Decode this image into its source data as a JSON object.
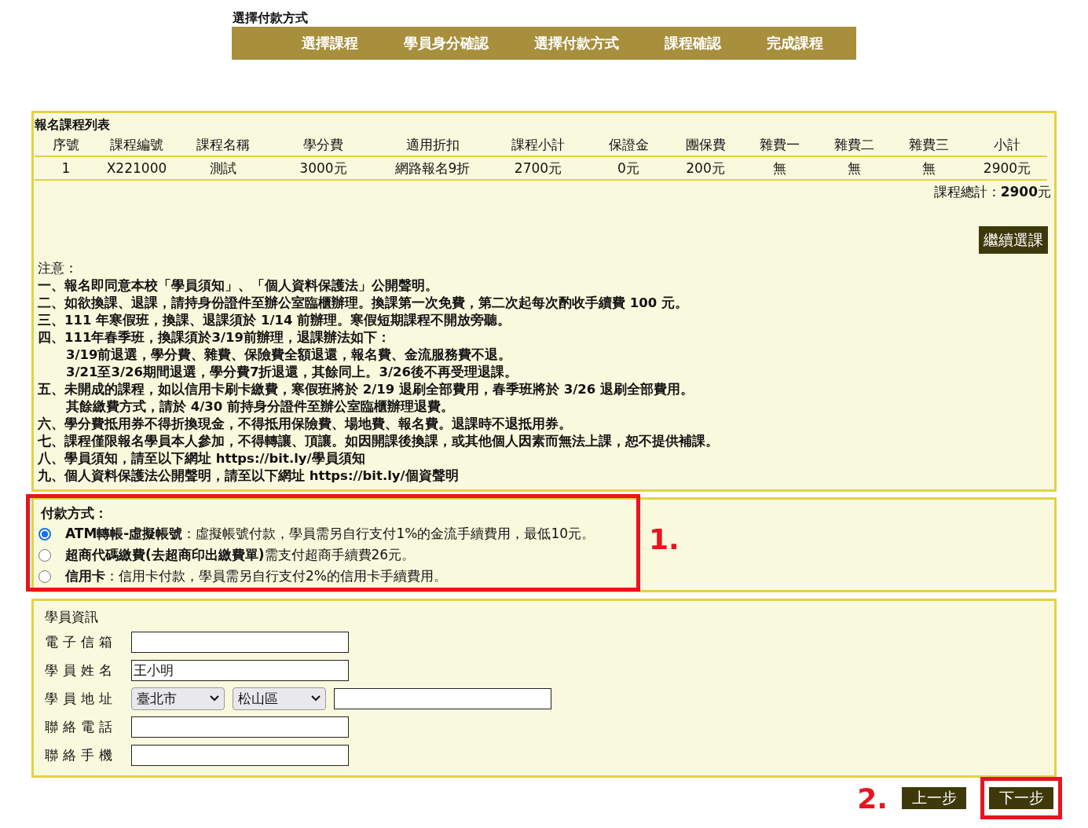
{
  "page_title": "選擇付款方式",
  "steps": [
    "選擇課程",
    "學員身分確認",
    "選擇付款方式",
    "課程確認",
    "完成課程"
  ],
  "course_list": {
    "title": "報名課程列表",
    "columns": [
      "序號",
      "課程編號",
      "課程名稱",
      "學分費",
      "適用折扣",
      "課程小計",
      "保證金",
      "團保費",
      "雜費一",
      "雜費二",
      "雜費三",
      "小計"
    ],
    "rows": [
      [
        "1",
        "X221000",
        "測試",
        "3000元",
        "網路報名9折",
        "2700元",
        "0元",
        "200元",
        "無",
        "無",
        "無",
        "2900元"
      ]
    ],
    "total": "課程總計：**2900**元",
    "continue_button": "繼續選課"
  },
  "notes": {
    "heading": "注意：",
    "items": [
      {
        "text": "一、報名即同意本校「學員須知」、「個人資料保護法」公開聲明。"
      },
      {
        "text": "二、如欲換課、退課，請持身份證件至辦公室臨櫃辦理。換課第一次免費，第二次起每次酌收手續費 100 元。"
      },
      {
        "text": "三、111 年寒假班，換課、退課須於 1/14 前辦理。寒假短期課程不開放旁聽。"
      },
      {
        "text": "四、111年春季班，換課須於3/19前辦理，退課辦法如下：",
        "lines": [
          "3/19前退選，學分費、雜費、保險費全額退還，報名費、金流服務費不退。",
          "3/21至3/26期間退選，學分費7折退還，其餘同上。3/26後不再受理退課。"
        ]
      },
      {
        "text": "五、未開成的課程，如以信用卡刷卡繳費，寒假班將於 2/19 退刷全部費用，春季班將於 3/26 退刷全部費用。",
        "lines": [
          "其餘繳費方式，請於 4/30 前持身分證件至辦公室臨櫃辦理退費。"
        ]
      },
      {
        "text": "六、學分費抵用券不得折換現金，不得抵用保險費、場地費、報名費。退課時不退抵用券。"
      },
      {
        "text": "七、課程僅限報名學員本人參加，不得轉讓、頂讓。如因開課後換課，或其他個人因素而無法上課，恕不提供補課。"
      },
      {
        "text": "八、學員須知，請至以下網址 https://bit.ly/學員須知"
      },
      {
        "text": "九、個人資料保護法公開聲明，請至以下網址 https://bit.ly/個資聲明"
      }
    ]
  },
  "payment": {
    "heading": "付款方式：",
    "options": [
      {
        "text": "**ATM轉帳-虛擬帳號**：虛擬帳號付款，學員需另自行支付1%的金流手續費用，最低10元。",
        "selected": true
      },
      {
        "text": "**超商代碼繳費(去超商印出繳費單)**需支付超商手續費26元。",
        "selected": false
      },
      {
        "text": "**信用卡**：信用卡付款，學員需另自行支付2%的信用卡手續費用。",
        "selected": false
      }
    ]
  },
  "student": {
    "heading": "學員資訊",
    "fields": [
      {
        "kind": "text",
        "label": "電子信箱"
      },
      {
        "kind": "text",
        "label": "學員姓名",
        "value": "王小明"
      },
      {
        "kind": "address",
        "label": "學員地址",
        "city": "臺北市",
        "district": "松山區"
      },
      {
        "kind": "text",
        "label": "聯絡電話"
      },
      {
        "kind": "text",
        "label": "聯絡手機"
      }
    ]
  },
  "buttons": {
    "previous": "上一步",
    "next": "下一步"
  },
  "annotations": [
    "1.",
    "2."
  ]
}
